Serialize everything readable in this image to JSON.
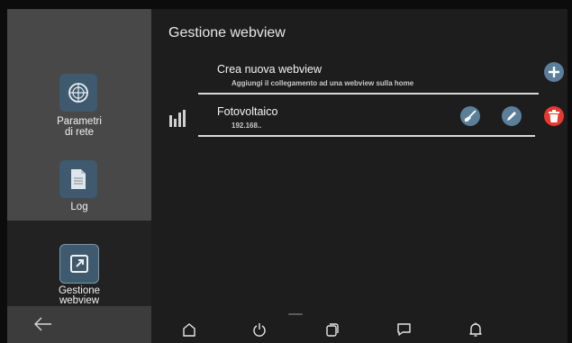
{
  "page_title": "Gestione webview",
  "sidebar": {
    "items": [
      {
        "label_line1": "Parametri",
        "label_line2": "di rete",
        "icon": "network-icon"
      },
      {
        "label_line1": "Log",
        "label_line2": "",
        "icon": "document-icon"
      },
      {
        "label_line1": "Gestione",
        "label_line2": "webview",
        "icon": "webview-icon"
      }
    ],
    "back_icon": "back-arrow-icon"
  },
  "create_row": {
    "title": "Crea nuova webview",
    "subtitle": "Aggiungi il collegamento ad una webview sulla home",
    "action_icon": "plus-icon"
  },
  "webviews": [
    {
      "name": "Fotovoltaico",
      "address": "192.168..",
      "icon": "bars-icon",
      "actions": [
        "broom-icon",
        "pencil-icon",
        "trash-icon"
      ]
    }
  ],
  "colors": {
    "accent_blue": "#5b7e99",
    "delete_red": "#e8392f",
    "sidebar_bg": "#484848",
    "main_bg": "#1d1d1d"
  },
  "navbar": {
    "icons": [
      "home-icon",
      "power-icon",
      "recents-icon",
      "message-icon",
      "bell-icon"
    ]
  }
}
